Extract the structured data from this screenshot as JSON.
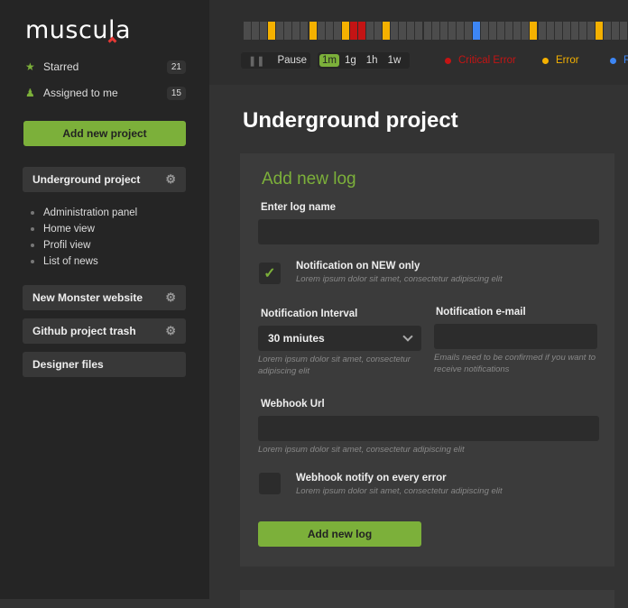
{
  "app": {
    "logo": "muscula"
  },
  "sidebar": {
    "nav": [
      {
        "label": "Starred",
        "count": "21",
        "icon": "star-icon"
      },
      {
        "label": "Assigned to me",
        "count": "15",
        "icon": "user-icon"
      }
    ],
    "add_project": "Add new project",
    "projects": [
      {
        "label": "Underground project"
      },
      {
        "label": "New Monster website"
      },
      {
        "label": "Github project trash"
      },
      {
        "label": "Designer files"
      }
    ],
    "subitems": [
      "Administration panel",
      "Home view",
      "Profil view",
      "List of news"
    ]
  },
  "topbar": {
    "timeline": [
      "n",
      "n",
      "n",
      "e",
      "n",
      "n",
      "n",
      "n",
      "e",
      "n",
      "n",
      "n",
      "e",
      "c",
      "c",
      "n",
      "n",
      "e",
      "n",
      "n",
      "n",
      "n",
      "n",
      "n",
      "n",
      "n",
      "n",
      "n",
      "i",
      "n",
      "n",
      "n",
      "n",
      "n",
      "n",
      "e",
      "n",
      "n",
      "n",
      "n",
      "n",
      "n",
      "n",
      "e",
      "n",
      "n",
      "n",
      "n"
    ],
    "colors": {
      "n": "#4c4c4c",
      "e": "#f5b100",
      "c": "#c41414",
      "i": "#3d86f5",
      "accent": "#7cb03a"
    },
    "pause": "Pause",
    "ranges": [
      {
        "label": "1m",
        "active": true
      },
      {
        "label": "1g"
      },
      {
        "label": "1h"
      },
      {
        "label": "1w"
      }
    ],
    "legend": [
      {
        "label": "Critical Error",
        "color": "#c41414"
      },
      {
        "label": "Error",
        "color": "#f5b100"
      },
      {
        "label": "R",
        "color": "#3d86f5"
      }
    ]
  },
  "main": {
    "title": "Underground project",
    "form": {
      "heading": "Add new log",
      "log_name_label": "Enter log name",
      "log_name_value": "",
      "notify_new": {
        "label": "Notification on NEW only",
        "hint": "Lorem ipsum dolor sit amet, consectetur adipiscing elit",
        "checked": true
      },
      "interval_label": "Notification Interval",
      "interval_value": "30 mniutes",
      "interval_hint": "Lorem ipsum dolor sit amet, consectetur adipiscing elit",
      "email_label": "Notification e-mail",
      "email_value": "",
      "email_hint": "Emails need to be confirmed if you want to receive notifications",
      "webhook_label": "Webhook Url",
      "webhook_value": "",
      "webhook_hint": "Lorem ipsum dolor sit amet, consectetur adipiscing elit",
      "webhook_notify": {
        "label": "Webhook notify on every error",
        "hint": "Lorem ipsum dolor sit amet, consectetur adipiscing elit",
        "checked": false
      },
      "submit": "Add new log"
    }
  }
}
